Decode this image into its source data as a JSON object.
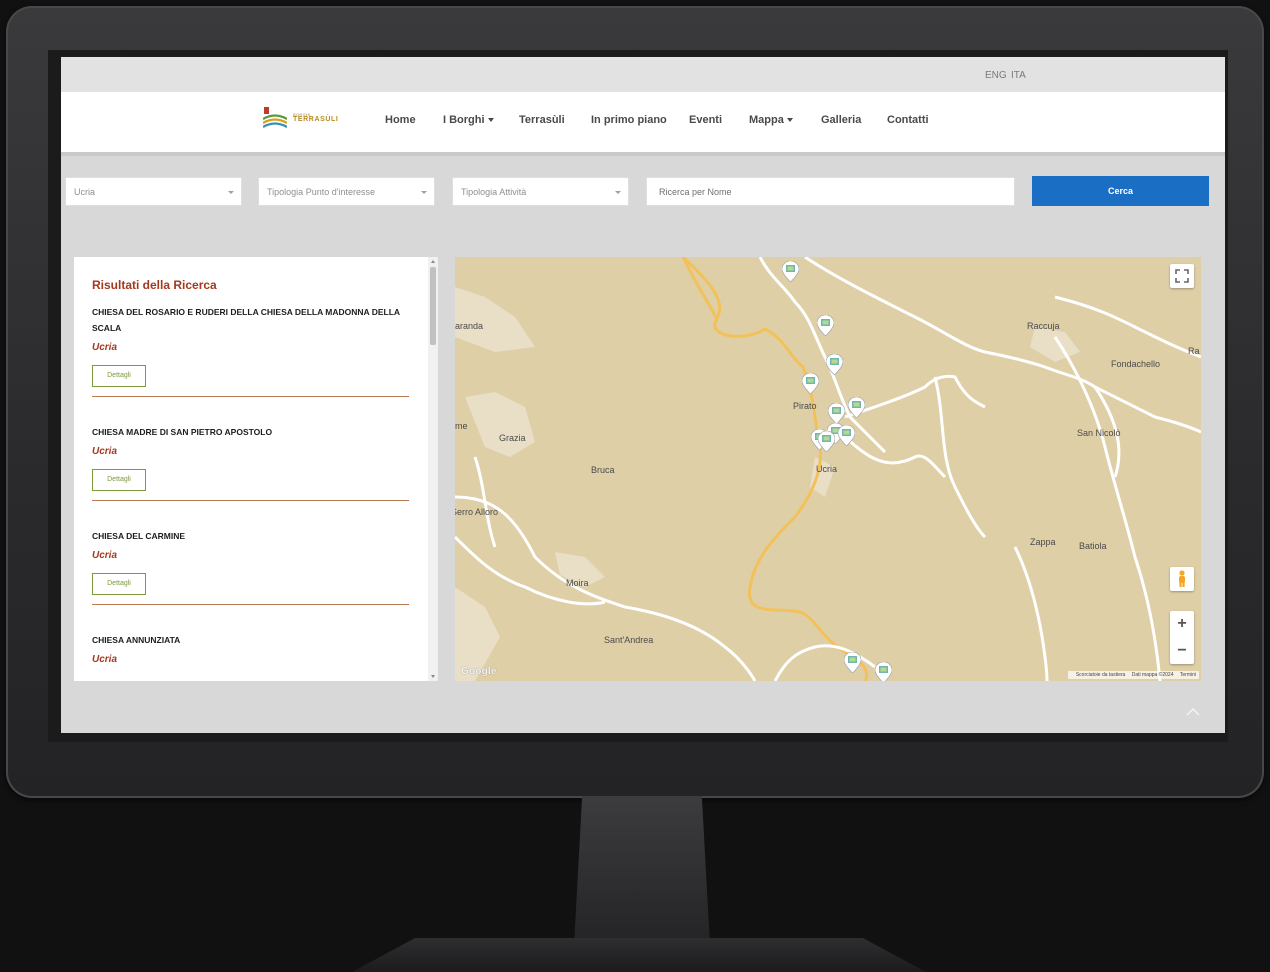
{
  "language_bar": {
    "eng": "ENG",
    "ita": "ITA"
  },
  "logo": {
    "small_text": "BORGHI",
    "name": "TERRASÙLI"
  },
  "nav": {
    "home": "Home",
    "borghi": "I Borghi",
    "terrasuli": "Terrasùli",
    "in_primo_piano": "In primo piano",
    "eventi": "Eventi",
    "mappa": "Mappa",
    "galleria": "Galleria",
    "contatti": "Contatti"
  },
  "filters": {
    "borgo": "Ucria",
    "tipologia_punto": "Tipologia Punto d'interesse",
    "tipologia_attivita": "Tipologia Attività",
    "search_placeholder": "Ricerca per Nome",
    "search_button": "Cerca"
  },
  "results": {
    "title": "Risultati della Ricerca",
    "details_label": "Dettagli",
    "items": [
      {
        "name": "CHIESA DEL ROSARIO E RUDERI DELLA CHIESA DELLA MADONNA DELLA SCALA",
        "place": "Ucria"
      },
      {
        "name": "CHIESA MADRE DI SAN PIETRO APOSTOLO",
        "place": "Ucria"
      },
      {
        "name": "CHIESA DEL CARMINE",
        "place": "Ucria"
      },
      {
        "name": "CHIESA ANNUNZIATA",
        "place": "Ucria"
      }
    ]
  },
  "map": {
    "labels": {
      "aranda": "aranda",
      "raccuja": "Raccuja",
      "ra": "Ra",
      "fondachello": "Fondachello",
      "pirato": "Pirato",
      "me": "me",
      "grazia": "Grazia",
      "san_nicolo": "San Nicolò",
      "bruca": "Bruca",
      "ucria": "Ucria",
      "serro_alloro": "Serro Alloro",
      "zappa": "Zappa",
      "batiola": "Batiola",
      "moira": "Moira",
      "sant_andrea": "Sant'Andrea"
    },
    "google": "Google",
    "zoom_in": "+",
    "zoom_out": "−",
    "footer": {
      "keyboard": "Scorciatoie da tastiera",
      "data": "Dati mappa ©2024",
      "terms": "Termini"
    }
  },
  "colors": {
    "accent_red": "#a3391f",
    "primary_blue": "#1a6fc4",
    "details_green": "#7d9a3c",
    "map_land": "#dfcfa7",
    "road_yellow": "#f2c15a"
  },
  "icons": {
    "fullscreen": "fullscreen-icon",
    "pegman": "pegman-icon",
    "marker": "map-marker-icon",
    "back_to_top": "chevron-up-icon"
  }
}
